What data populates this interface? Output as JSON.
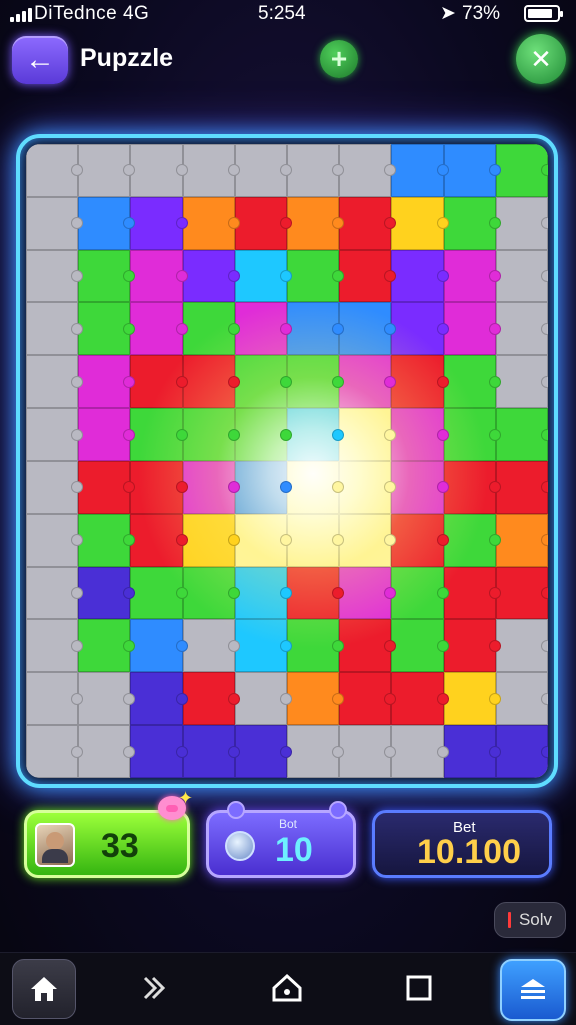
{
  "status": {
    "carrier": "DiTednce  4G",
    "time": "5:254",
    "battery_text": "73%"
  },
  "header": {
    "title": "Pupzzle",
    "back_icon": "arrow-left-icon",
    "add_icon": "plus-icon",
    "close_icon": "close-icon"
  },
  "board": {
    "rows": 12,
    "cols": 10,
    "colors": {
      "g": "#b9b9c2",
      "b": "#2f8cff",
      "p": "#7a2cff",
      "o": "#ff8a1e",
      "r": "#ec1c2c",
      "y": "#ffd21e",
      "l": "#3ed83a",
      "m": "#e02cd8",
      "c": "#1ec8ff",
      "w": "#fff6a0",
      "d": "#4a2fd6"
    },
    "layout": [
      "gggggggbbl",
      "gbpororylg",
      "glmpclrpmg",
      "glmlmbbpmg",
      "gmrrllmrlg",
      "gmlllcwmll",
      "grrmbwwmrr",
      "glrywwwrlo",
      "gdllcrmlrr",
      "glbgclrlrg",
      "ggdrgorryg",
      "ggdddgggdd"
    ]
  },
  "scores": {
    "player": {
      "value": "33"
    },
    "bots": {
      "label": "Bot",
      "value": "10"
    },
    "bet": {
      "label": "Bet",
      "value": "10.100"
    }
  },
  "solve_label": "Solv",
  "nav": {
    "home_icon": "home-icon",
    "forward_icon": "chevrons-right-icon",
    "house_icon": "house-outline-icon",
    "square_icon": "square-icon",
    "menu_icon": "menu-stack-icon"
  }
}
